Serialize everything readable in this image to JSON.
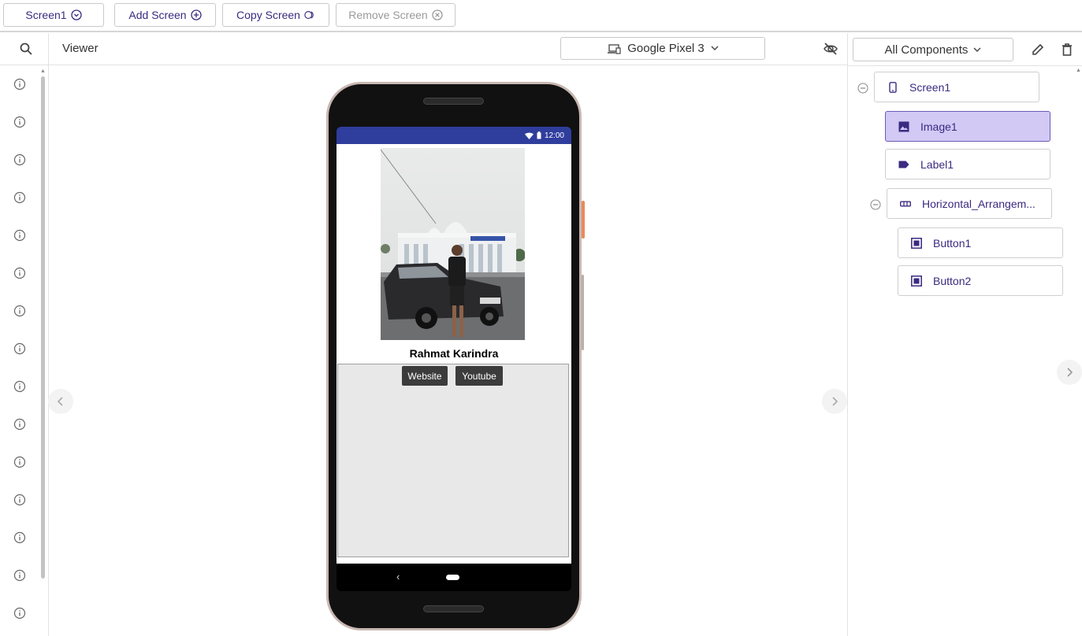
{
  "toolbar": {
    "screen_select": "Screen1",
    "add_screen": "Add Screen",
    "copy_screen": "Copy Screen",
    "remove_screen": "Remove Screen"
  },
  "viewer": {
    "title": "Viewer",
    "device": "Google Pixel 3"
  },
  "phone": {
    "status_time": "12:00",
    "label_text": "Rahmat Karindra",
    "buttons": [
      "Website",
      "Youtube"
    ]
  },
  "components_panel": {
    "filter": "All Components",
    "tree": [
      {
        "name": "Screen1",
        "icon": "phone-icon"
      },
      {
        "name": "Image1",
        "icon": "image-icon",
        "selected": true
      },
      {
        "name": "Label1",
        "icon": "label-icon"
      },
      {
        "name": "Horizontal_Arrangem...",
        "icon": "horizontal-arrangement-icon"
      },
      {
        "name": "Button1",
        "icon": "button-icon"
      },
      {
        "name": "Button2",
        "icon": "button-icon"
      }
    ]
  },
  "colors": {
    "accent": "#3b2a80",
    "selected_bg": "#d2c9f5",
    "status_bar": "#2f3d9c"
  }
}
